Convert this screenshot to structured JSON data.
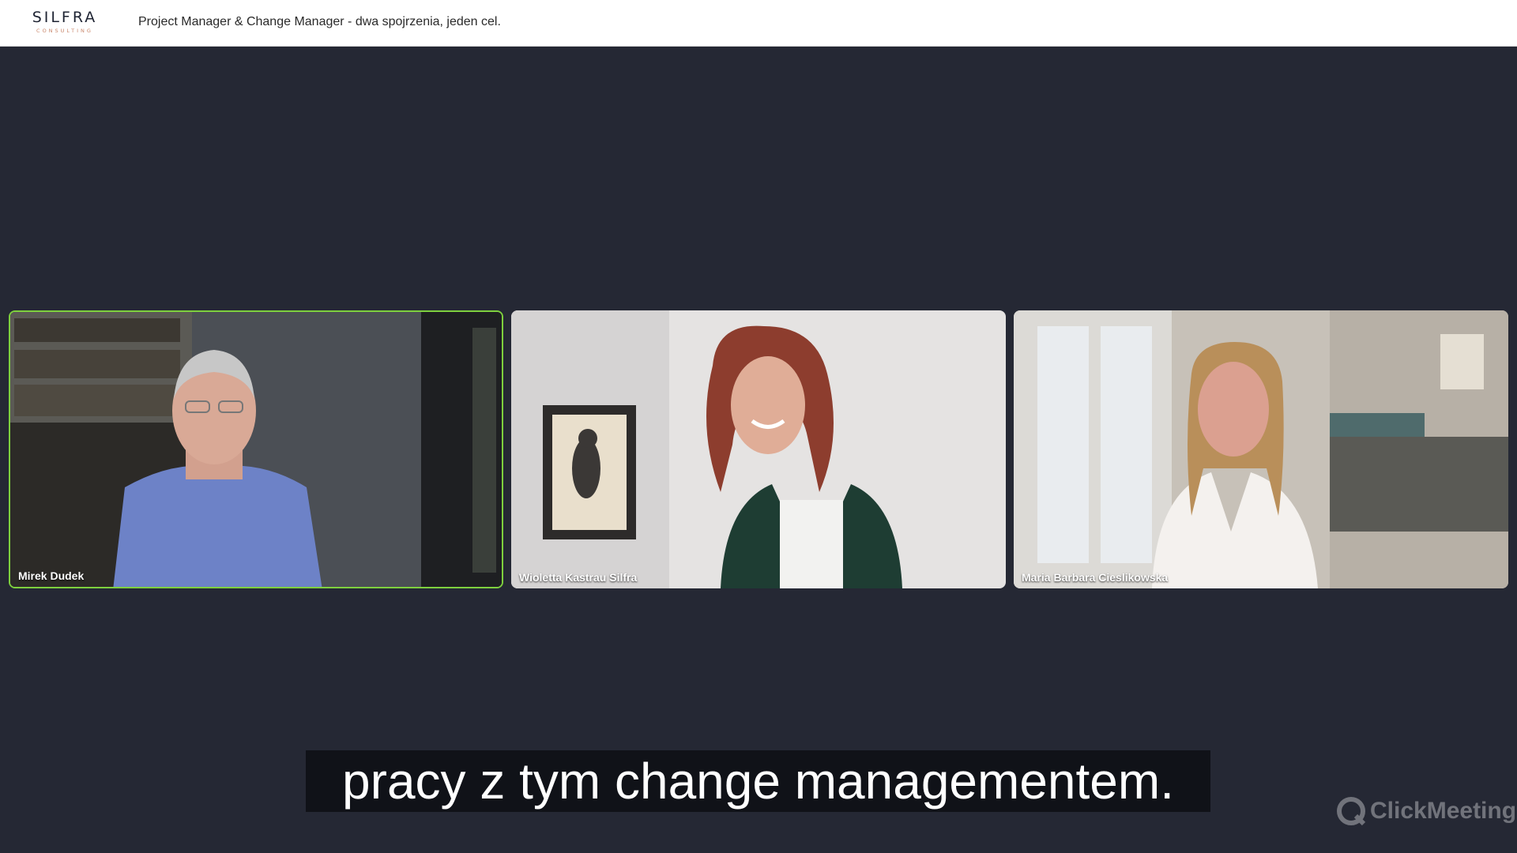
{
  "header": {
    "logo_main": "SILFRA",
    "logo_sub": "CONSULTING",
    "title": "Project Manager & Change Manager - dwa spojrzenia, jeden cel."
  },
  "participants": [
    {
      "name": "Mirek Dudek",
      "active": true
    },
    {
      "name": "Wioletta Kastrau Silfra",
      "active": false
    },
    {
      "name": "Maria Barbara Cieslikowska",
      "active": false
    }
  ],
  "subtitle": "pracy z tym change managementem.",
  "watermark": "ClickMeeting",
  "colors": {
    "background": "#252834",
    "active_speaker_border": "#7ed03e",
    "header_bg": "#ffffff",
    "logo_accent": "#c9866a"
  }
}
